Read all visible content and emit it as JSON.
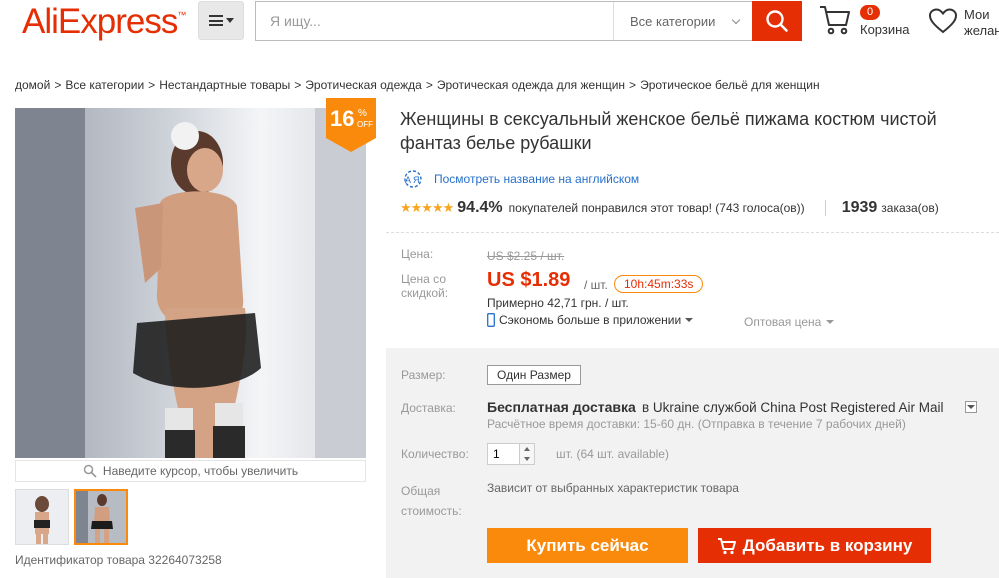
{
  "header": {
    "logo": "AliExpress",
    "logo_tm": "™",
    "search_placeholder": "Я ищу...",
    "category_select": "Все категории",
    "cart_count": "0",
    "cart_label": "Корзина",
    "wishlist_label": "Мои желан"
  },
  "breadcrumb": [
    "домой",
    "Все категории",
    "Нестандартные товары",
    "Эротическая одежда",
    "Эротическая одежда для женщин",
    "Эротическое бельё для женщин"
  ],
  "breadcrumb_sep": ">",
  "gallery": {
    "discount_pct": "16",
    "discount_pct_sign": "%",
    "discount_off": "OFF",
    "hover_hint": "Наведите курсор, чтобы увеличить",
    "product_id": "Идентификатор товара 32264073258"
  },
  "product": {
    "title": "Женщины в сексуальный женское бельё пижама костюм чистой фантаз белье рубашки",
    "translate_link": "Посмотреть название на английском",
    "stars": "★★★★★",
    "rating_value": 4.5,
    "rating_pct": "94.4%",
    "rating_text": "покупателей понравился этот товар! (743 голоса(ов))",
    "orders_count": "1939",
    "orders_label": "заказа(ов)"
  },
  "price": {
    "price_label": "Цена:",
    "old_price": "US $2.25 / шт.",
    "discount_label": "Цена со скидкой:",
    "new_price": "US $1.89",
    "unit": "/ шт.",
    "timer": "10h:45m:33s",
    "approx": "Примерно 42,71 грн. / шт.",
    "app_save": "Сэкономь больше в приложении",
    "wholesale": "Оптовая цена"
  },
  "options": {
    "size_label": "Размер:",
    "size_value": "Один Размер",
    "shipping_label": "Доставка:",
    "shipping_free": "Бесплатная доставка",
    "shipping_rest": "в Ukraine службой China Post Registered Air Mail",
    "shipping_time": "Расчётное время доставки: 15-60 дн. (Отправка в течение 7 рабочих дней)",
    "qty_label": "Количество:",
    "qty_value": "1",
    "qty_available": "шт. (64 шт. available)",
    "total_label": "Общая стоимость:",
    "total_value": "Зависит от выбранных характеристик товара"
  },
  "actions": {
    "buy_now": "Купить сейчас",
    "add_to_cart": "Добавить в корзину"
  },
  "colors": {
    "brand_red": "#e62e04",
    "orange": "#f98a0c",
    "link_blue": "#2770cb",
    "star": "#f5a623"
  }
}
